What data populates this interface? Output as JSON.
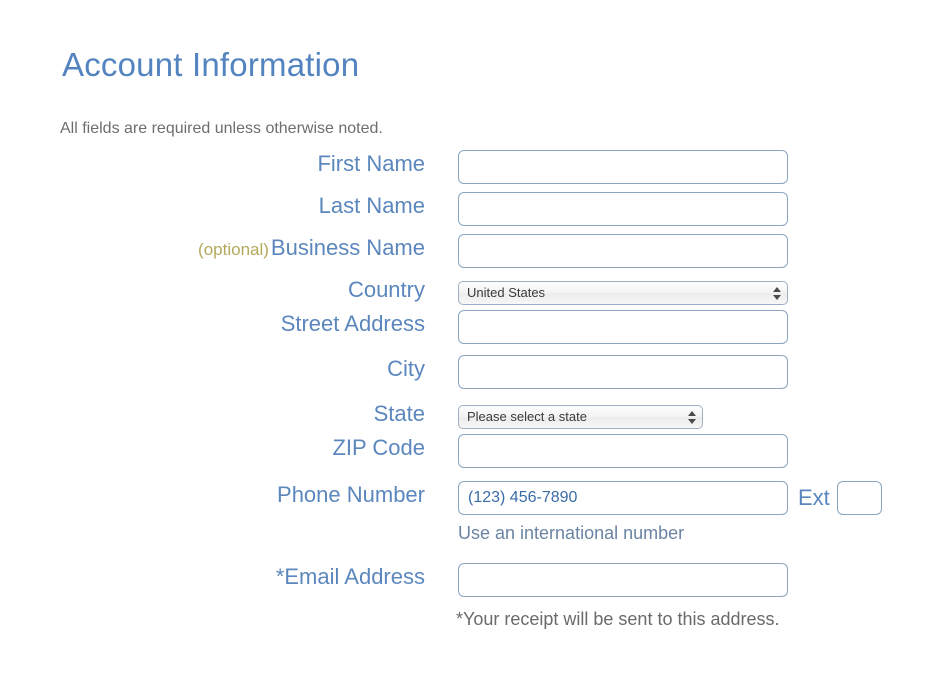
{
  "header": {
    "title": "Account Information",
    "subtitle": "All fields are required unless otherwise noted."
  },
  "colors": {
    "heading": "#5484c0",
    "label": "#5b87bd",
    "optional": "#b3a95c",
    "input_border": "#8ba6bf",
    "input_text": "#3f6ea8",
    "helper_text": "#6a6a6a",
    "link": "#6b84a3",
    "background": "#ffffff"
  },
  "form": {
    "fields": {
      "first_name": {
        "label": "First Name",
        "value": "",
        "placeholder": ""
      },
      "last_name": {
        "label": "Last Name",
        "value": "",
        "placeholder": ""
      },
      "business_name": {
        "optional_tag": "(optional)",
        "label": "Business Name",
        "value": "",
        "placeholder": ""
      },
      "country": {
        "label": "Country",
        "selected": "United States"
      },
      "street_address": {
        "label": "Street Address",
        "value": "",
        "placeholder": ""
      },
      "city": {
        "label": "City",
        "value": "",
        "placeholder": ""
      },
      "state": {
        "label": "State",
        "selected": "Please select a state"
      },
      "zip_code": {
        "label": "ZIP Code",
        "value": "",
        "placeholder": ""
      },
      "phone_number": {
        "label": "Phone Number",
        "value": "",
        "placeholder": "(123) 456-7890",
        "ext_label": "Ext",
        "ext_value": "",
        "helper_link": "Use an international number"
      },
      "email_address": {
        "label": "*Email Address",
        "value": "",
        "placeholder": "",
        "note": "*Your receipt will be sent to this address."
      }
    }
  },
  "icons": {
    "select_arrows": "select-stepper-arrows-icon"
  }
}
